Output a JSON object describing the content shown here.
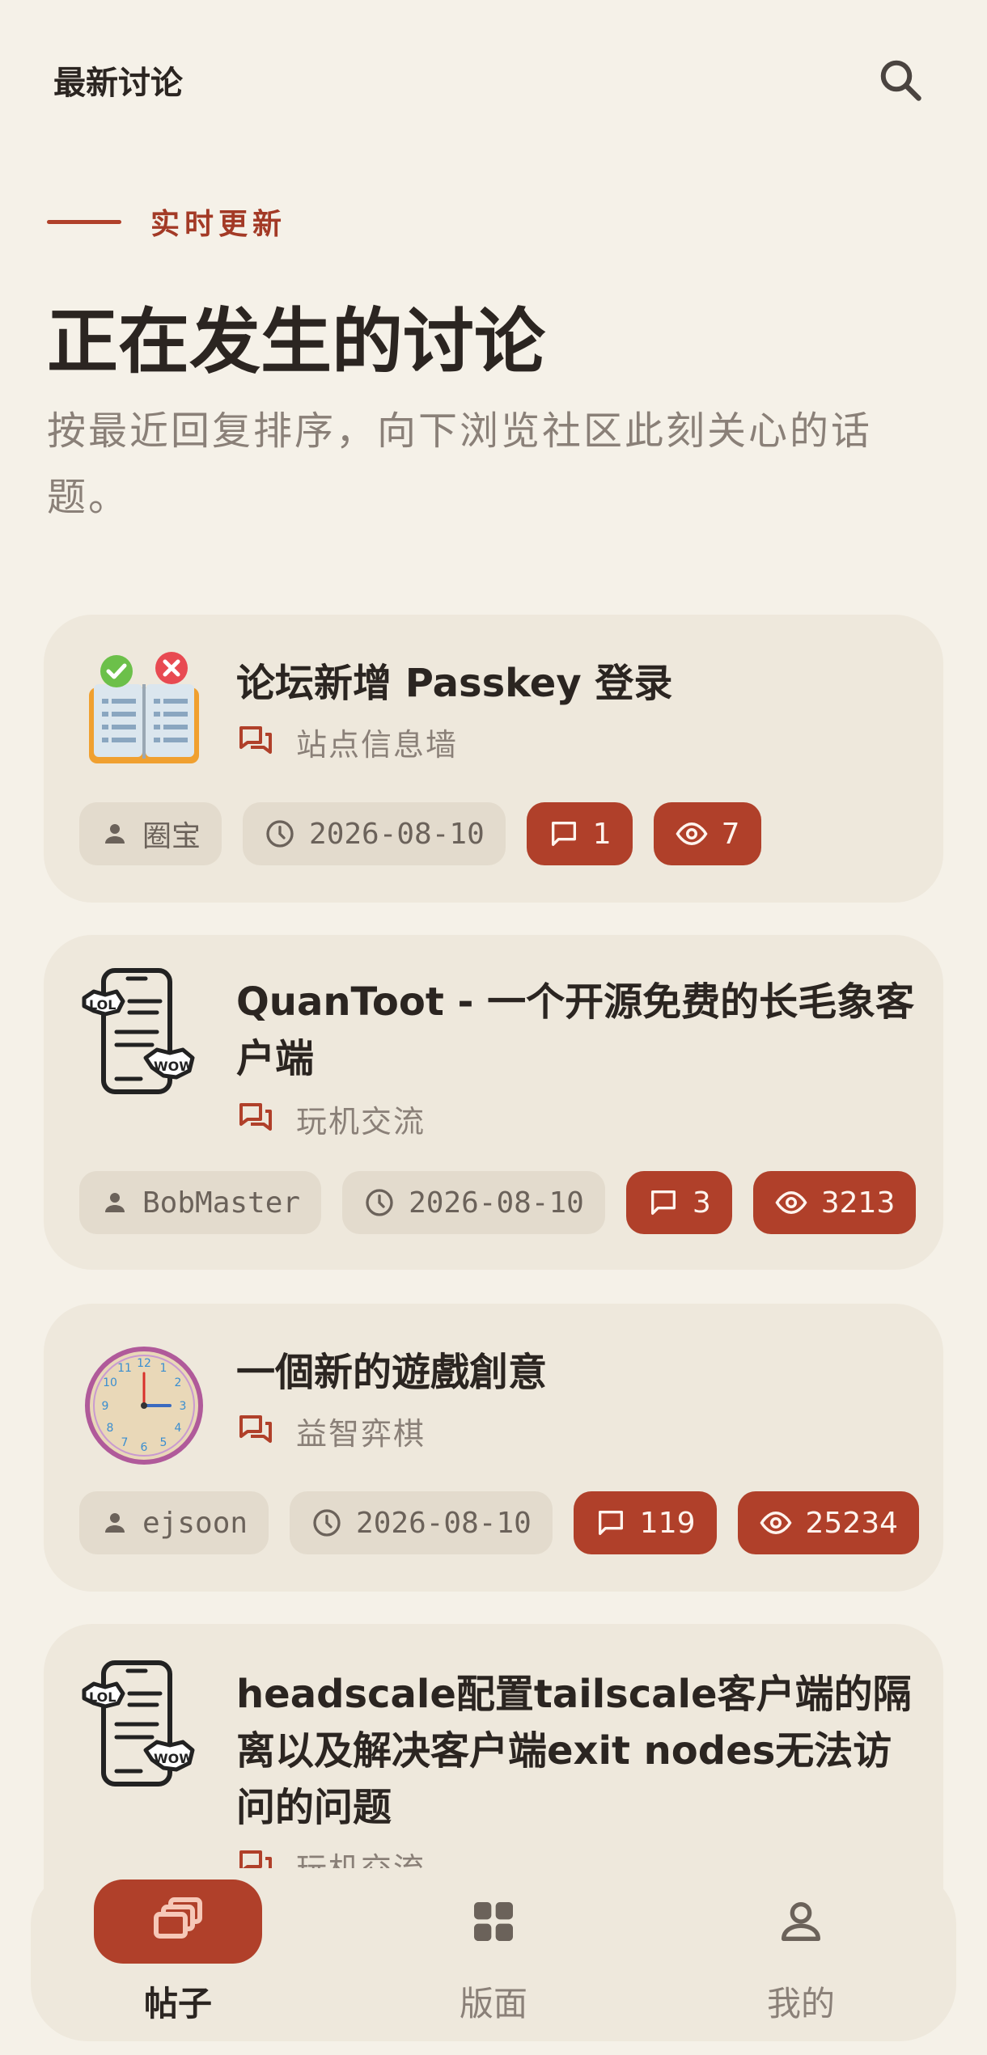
{
  "header": {
    "title": "最新讨论",
    "search_icon": "search-icon"
  },
  "hero": {
    "eyebrow": "实时更新",
    "title": "正在发生的讨论",
    "description": "按最近回复排序，向下浏览社区此刻关心的话题。"
  },
  "theme": {
    "accent": "#b0402a",
    "background": "#f5f1e8",
    "card": "#eee8dc"
  },
  "posts": [
    {
      "title": "论坛新增 Passkey 登录",
      "board": "站点信息墙",
      "author": "圈宝",
      "date": "2026-08-10",
      "replies": "1",
      "views": "7",
      "icon": "book-checklist-icon"
    },
    {
      "title": "QuanToot - 一个开源免费的长毛象客户端",
      "board": "玩机交流",
      "author": "BobMaster",
      "date": "2026-08-10",
      "replies": "3",
      "views": "3213",
      "icon": "phone-lol-wow-icon"
    },
    {
      "title": "一個新的遊戲創意",
      "board": "益智弈棋",
      "author": "ejsoon",
      "date": "2026-08-10",
      "replies": "119",
      "views": "25234",
      "icon": "clock-icon"
    },
    {
      "title": "headscale配置tailscale客户端的隔离以及解决客户端exit nodes无法访问的问题",
      "board": "玩机交流",
      "icon": "phone-lol-wow-icon"
    }
  ],
  "nav": [
    {
      "label": "帖子",
      "icon": "posts-icon",
      "active": true
    },
    {
      "label": "版面",
      "icon": "boards-grid-icon",
      "active": false
    },
    {
      "label": "我的",
      "icon": "profile-icon",
      "active": false
    }
  ]
}
